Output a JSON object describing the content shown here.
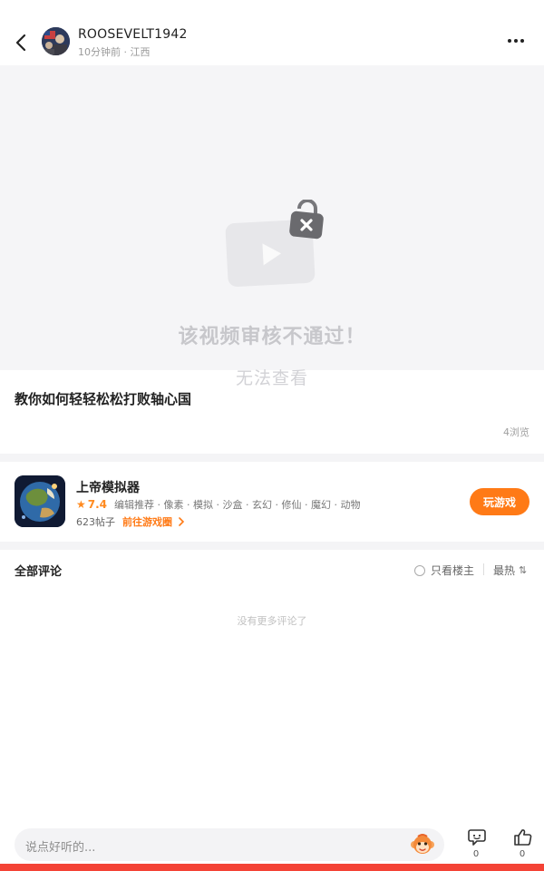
{
  "header": {
    "username": "ROOSEVELT1942",
    "meta": "10分钟前 · 江西"
  },
  "video": {
    "status": "该视频审核不通过！",
    "sub": "无法查看"
  },
  "post": {
    "title": "教你如何轻轻松松打败轴心国",
    "views": "4浏览"
  },
  "game": {
    "name": "上帝模拟器",
    "rating": "7.4",
    "tags": "编辑推荐 · 像素 · 模拟 · 沙盒 · 玄幻 · 修仙 · 魔幻 · 动物",
    "posts": "623帖子",
    "go_circle": "前往游戏圈",
    "play_label": "玩游戏"
  },
  "comments": {
    "title": "全部评论",
    "op_only": "只看楼主",
    "sort": "最热",
    "empty": "没有更多评论了"
  },
  "bottom": {
    "placeholder": "说点好听的...",
    "comment_count": "0",
    "like_count": "0"
  },
  "colors": {
    "accent": "#ff7a16",
    "strip": "#f44336"
  }
}
